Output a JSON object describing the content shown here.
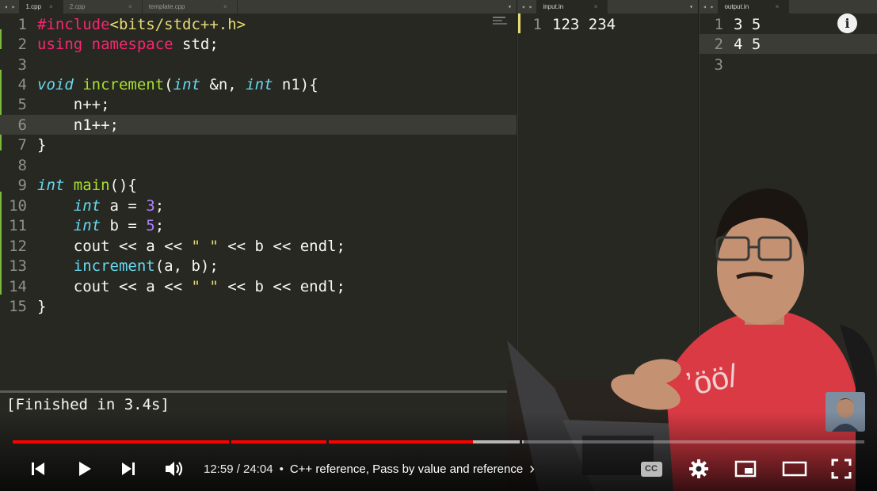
{
  "editor": {
    "tabs_left": [
      {
        "label": "1.cpp",
        "active": true
      },
      {
        "label": "2.cpp",
        "active": false
      },
      {
        "label": "template.cpp",
        "active": false
      }
    ],
    "tabs_mid": [
      {
        "label": "input.in",
        "active": true
      }
    ],
    "tabs_right": [
      {
        "label": "output.in",
        "active": true
      }
    ],
    "nav_arrows": "◂ ▸",
    "dropdown": "▾",
    "close": "×",
    "source_lines": [
      {
        "n": "1"
      },
      {
        "n": "2"
      },
      {
        "n": "3"
      },
      {
        "n": "4"
      },
      {
        "n": "5"
      },
      {
        "n": "6"
      },
      {
        "n": "7"
      },
      {
        "n": "8"
      },
      {
        "n": "9"
      },
      {
        "n": "10"
      },
      {
        "n": "11"
      },
      {
        "n": "12"
      },
      {
        "n": "13"
      },
      {
        "n": "14"
      },
      {
        "n": "15"
      }
    ],
    "code": {
      "l1_pre": "#include",
      "l1_inc": "<bits/stdc++.h>",
      "l2_using": "using",
      "l2_ns": "namespace",
      "l2_rest": " std;",
      "l4_void": "void",
      "l4_name": "increment",
      "l4_p1": "(",
      "l4_int1": "int",
      "l4_p2": " &n, ",
      "l4_int2": "int",
      "l4_p3": " n1){",
      "l5": "    n++;",
      "l6": "    n1++;",
      "l7": "}",
      "l9_int": "int",
      "l9_main": "main",
      "l9_rest": "(){",
      "l10_int": "int",
      "l10_a": " a = ",
      "l10_num": "3",
      "l10_end": ";",
      "l11_int": "int",
      "l11_b": " b = ",
      "l11_num": "5",
      "l11_end": ";",
      "l12_a": "    cout << a << ",
      "l12_str": "\" \"",
      "l12_b": " << b << endl;",
      "l13_fn": "increment",
      "l13_rest": "(a, b);",
      "l14_a": "    cout << a << ",
      "l14_str": "\" \"",
      "l14_b": " << b << endl;",
      "l15": "}"
    },
    "input_lines": [
      {
        "n": "1",
        "text": "123 234"
      }
    ],
    "output_lines": [
      {
        "n": "1",
        "text": "3 5"
      },
      {
        "n": "2",
        "text": "4 5"
      },
      {
        "n": "3",
        "text": ""
      }
    ],
    "console": "[Finished in 3.4s]"
  },
  "player": {
    "time": "12:59 / 24:04",
    "separator": "•",
    "chapter": "C++ reference, Pass by value and reference",
    "chapter_chevron": "›",
    "progress_played": 0.54,
    "progress_buffered": 0.6,
    "cc_label": "CC",
    "info_label": "i"
  },
  "icons": {
    "prev": "previous-icon",
    "play": "play-icon",
    "next": "next-icon",
    "volume": "volume-icon",
    "cc": "captions-icon",
    "settings": "settings-gear-icon",
    "miniplayer": "miniplayer-icon",
    "theater": "theater-mode-icon",
    "fullscreen": "fullscreen-icon"
  },
  "colors": {
    "editor_bg": "#272822",
    "keyword": "#66d9ef",
    "function": "#a6e22e",
    "number": "#ae81ff",
    "string": "#e6db74",
    "preprocessor": "#f92672",
    "progress_red": "#ff0000"
  }
}
